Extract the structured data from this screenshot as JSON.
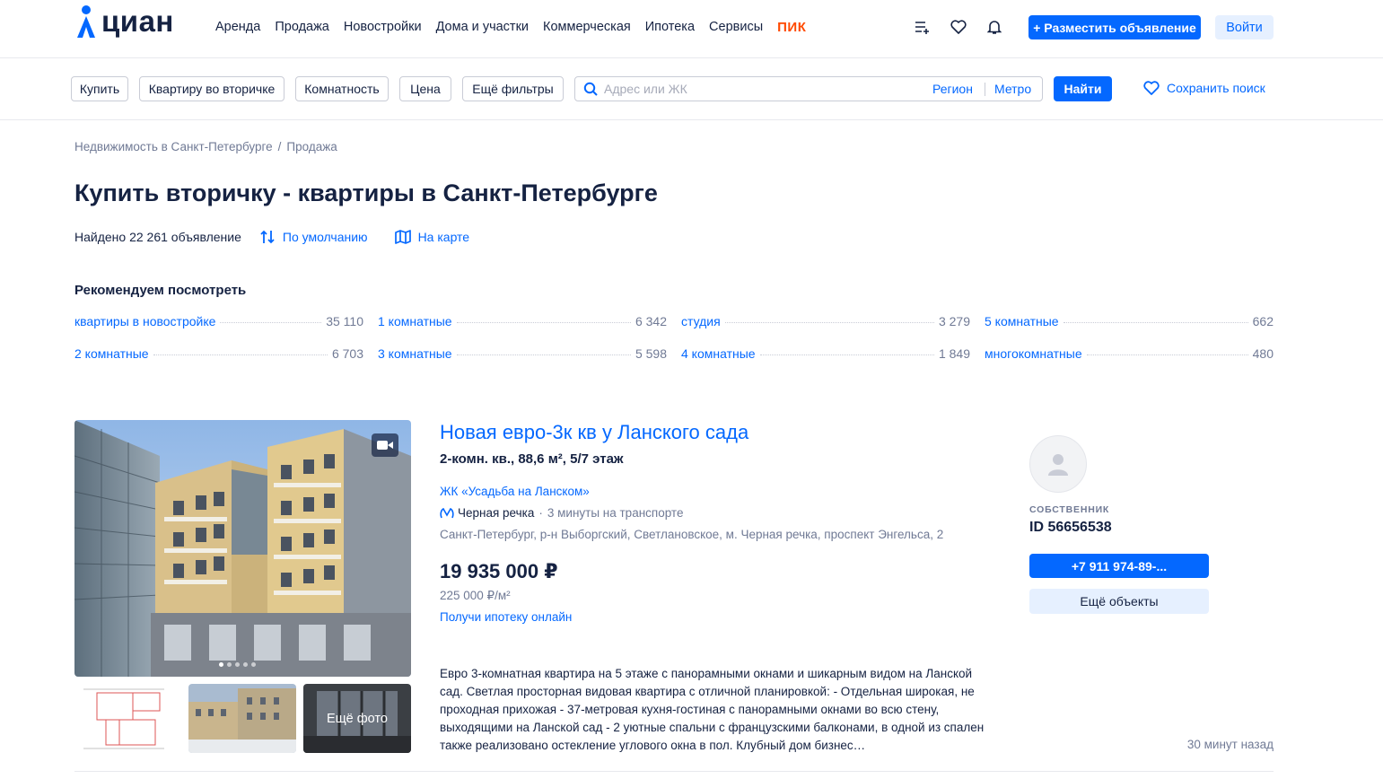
{
  "header": {
    "logo": "циан",
    "nav": [
      "Аренда",
      "Продажа",
      "Новостройки",
      "Дома и участки",
      "Коммерческая",
      "Ипотека",
      "Сервисы"
    ],
    "nav_pik": "ПИК",
    "post_button": "+ Разместить объявление",
    "login_button": "Войти"
  },
  "filters": {
    "buy": "Купить",
    "type": "Квартиру во вторичке",
    "rooms": "Комнатность",
    "price": "Цена",
    "more": "Ещё фильтры",
    "search_placeholder": "Адрес или ЖК",
    "region": "Регион",
    "metro": "Метро",
    "find": "Найти",
    "save_search": "Сохранить поиск"
  },
  "breadcrumb": [
    "Недвижимость в Санкт-Петербурге",
    "Продажа"
  ],
  "breadcrumb_sep": "/",
  "page_title": "Купить вторичку - квартиры в Санкт-Петербурге",
  "found_text": "Найдено 22 261 объявление",
  "sort_label": "По умолчанию",
  "map_label": "На карте",
  "recommend": {
    "title": "Рекомендуем посмотреть",
    "items": [
      {
        "label": "квартиры в новостройке",
        "count": "35 110"
      },
      {
        "label": "1 комнатные",
        "count": "6 342"
      },
      {
        "label": "студия",
        "count": "3 279"
      },
      {
        "label": "5 комнатные",
        "count": "662"
      },
      {
        "label": "2 комнатные",
        "count": "6 703"
      },
      {
        "label": "3 комнатные",
        "count": "5 598"
      },
      {
        "label": "4 комнатные",
        "count": "1 849"
      },
      {
        "label": "многокомнатные",
        "count": "480"
      }
    ]
  },
  "listing": {
    "title": "Новая евро-3к кв у Ланского сада",
    "subtitle": "2-комн. кв., 88,6 м², 5/7 этаж",
    "jk": "ЖК «Усадьба на Ланском»",
    "metro": "Черная речка",
    "metro_sep": "·",
    "metro_time": "3 минуты на транспорте",
    "address": "Санкт-Петербург, р-н Выборгский, Светлановское, м. Черная речка, проспект Энгельса, 2",
    "price": "19 935 000 ₽",
    "price_per_m": "225 000 ₽/м²",
    "mortgage": "Получи ипотеку онлайн",
    "more_photo": "Ещё фото",
    "description": "Евро 3-комнатная квартира на 5 этаже с панорамными окнами и шикарным видом на Ланской сад. Светлая просторная видовая квартира с отличной планировкой: - Отдельная широкая, не проходная прихожая - 37-метровая кухня-гостиная с панорамными окнами во всю стену, выходящими на Ланской сад - 2 уютные спальни с французскими балконами, в одной из спален также реализовано остекление углового окна в пол. Клубный дом бизнес…",
    "owner_role": "СОБСТВЕННИК",
    "owner_id": "ID 56656538",
    "phone": "+7 911 974-89-...",
    "more_objects": "Ещё объекты",
    "time_ago": "30 минут назад"
  },
  "colors": {
    "accent": "#0468ff",
    "text": "#152242",
    "muted": "#707a95",
    "pik": "#ff4a00"
  }
}
